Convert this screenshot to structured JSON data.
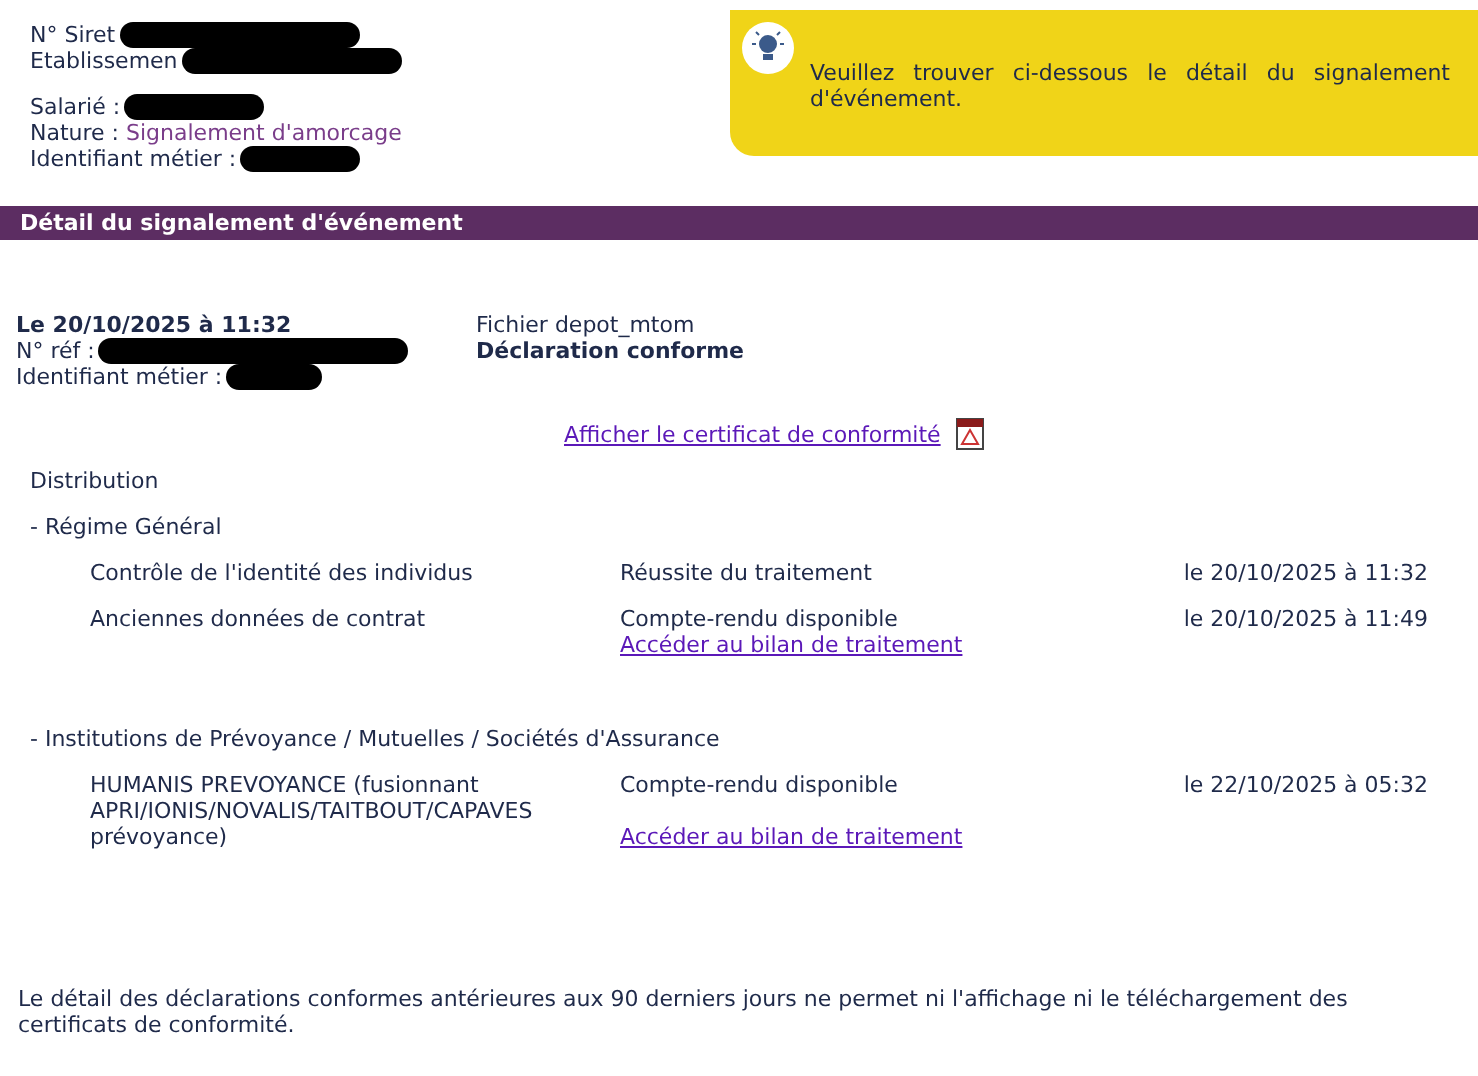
{
  "header": {
    "siret_label": "N° Siret",
    "etab_label": "Etablissemen",
    "salarie_label": "Salarié :",
    "nature_label": "Nature :",
    "nature_value": "Signalement d'amorcage",
    "identifiant_label": "Identifiant métier :"
  },
  "notice": {
    "text": "Veuillez trouver ci-dessous le détail du signalement d'événement."
  },
  "section_title": "Détail du signalement d'événement",
  "summary": {
    "date": "Le 20/10/2025 à 11:32",
    "ref_label": "N° réf :",
    "identifiant_label": "Identifiant métier :",
    "file": "Fichier depot_mtom",
    "status": "Déclaration conforme"
  },
  "certificate_link": "Afficher le certificat de conformité",
  "distribution_title": "Distribution",
  "groups": [
    {
      "title": "- Régime Général",
      "rows": [
        {
          "name": "Contrôle de l'identité des individus",
          "status": "Réussite du traitement",
          "date": "le 20/10/2025 à 11:32"
        },
        {
          "name": "Anciennes données de contrat",
          "status": "Compte-rendu disponible",
          "link": "Accéder au bilan de traitement",
          "date": "le 20/10/2025 à 11:49"
        }
      ]
    },
    {
      "title": "- Institutions de Prévoyance / Mutuelles / Sociétés d'Assurance",
      "rows": [
        {
          "name": "HUMANIS PREVOYANCE (fusionnant APRI/IONIS/NOVALIS/TAITBOUT/CAPAVES prévoyance)",
          "status": "Compte-rendu disponible",
          "link": "Accéder au bilan de traitement",
          "date": "le 22/10/2025 à 05:32"
        }
      ]
    }
  ],
  "footer_note": "Le détail des déclarations conformes antérieures aux 90 derniers jours ne permet ni l'affichage ni le téléchargement des certificats de conformité."
}
